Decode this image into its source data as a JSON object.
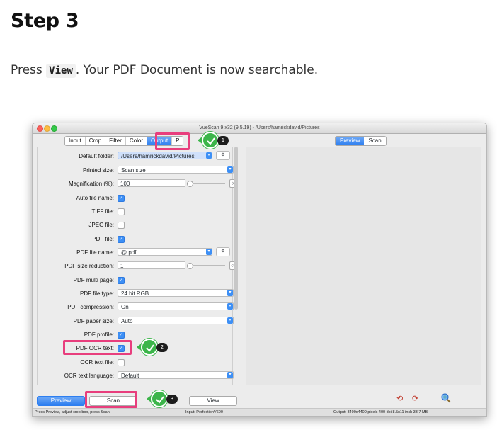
{
  "heading": "Step 3",
  "description": {
    "before": "Press ",
    "code": "View",
    "after": ". Your PDF Document is now searchable."
  },
  "window": {
    "title": "VueScan 9 x32 (9.5.19) - /Users/hamrickdavid/Pictures",
    "tabs": [
      "Input",
      "Crop",
      "Filter",
      "Color",
      "Output",
      "P"
    ],
    "active_tab": "Output",
    "right_tabs": [
      "Preview",
      "Scan"
    ],
    "active_right_tab": "Preview"
  },
  "settings": {
    "default_folder": {
      "label": "Default folder:",
      "value": "/Users/hamrickdavid/Pictures"
    },
    "printed_size": {
      "label": "Printed size:",
      "value": "Scan size"
    },
    "magnification": {
      "label": "Magnification (%):",
      "value": "100"
    },
    "auto_file_name": {
      "label": "Auto file name:",
      "checked": true
    },
    "tiff_file": {
      "label": "TIFF file:",
      "checked": false
    },
    "jpeg_file": {
      "label": "JPEG file:",
      "checked": false
    },
    "pdf_file": {
      "label": "PDF file:",
      "checked": true
    },
    "pdf_file_name": {
      "label": "PDF file name:",
      "value": "@.pdf"
    },
    "pdf_size_reduction": {
      "label": "PDF size reduction:",
      "value": "1"
    },
    "pdf_multi_page": {
      "label": "PDF multi page:",
      "checked": true
    },
    "pdf_file_type": {
      "label": "PDF file type:",
      "value": "24 bit RGB"
    },
    "pdf_compression": {
      "label": "PDF compression:",
      "value": "On"
    },
    "pdf_paper_size": {
      "label": "PDF paper size:",
      "value": "Auto"
    },
    "pdf_profile": {
      "label": "PDF profile:",
      "checked": true
    },
    "pdf_ocr_text": {
      "label": "PDF OCR text:",
      "checked": true
    },
    "ocr_text_file": {
      "label": "OCR text file:",
      "checked": false
    },
    "ocr_text_language": {
      "label": "OCR text language:",
      "value": "Default"
    }
  },
  "buttons": {
    "preview": "Preview",
    "scan": "Scan",
    "view": "View"
  },
  "status": {
    "left": "Press Preview, adjust crop box, press Scan",
    "middle": "Input: PerfectionV600",
    "right": "Output: 3400x4400 pixels 400 dpi 8.5x11 inch 33.7 MB"
  },
  "callouts": [
    "1",
    "2",
    "3"
  ],
  "colors": {
    "highlight": "#e83e7d",
    "callout_green": "#3cb54a",
    "accent_blue": "#3d8ff5"
  }
}
